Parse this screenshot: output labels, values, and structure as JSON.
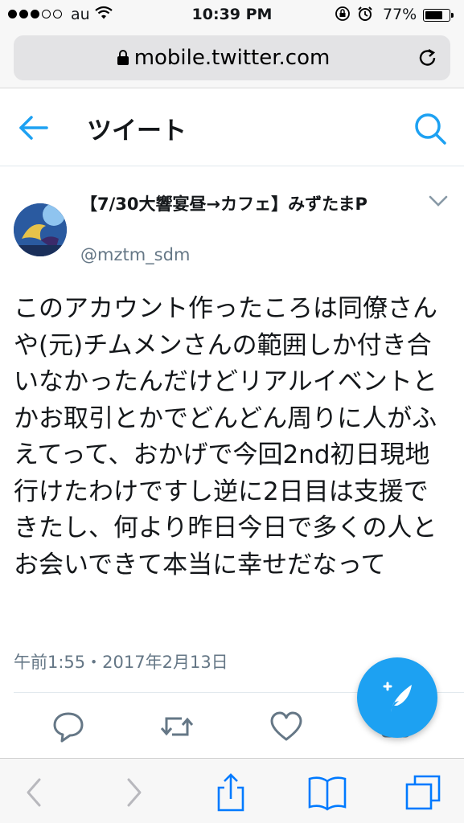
{
  "status_bar": {
    "carrier": "au",
    "time": "10:39 PM",
    "battery_percent": "77%",
    "battery_level": 0.77,
    "signal_bars_filled": 3,
    "signal_bars_total": 5
  },
  "browser": {
    "url": "mobile.twitter.com"
  },
  "header": {
    "title": "ツイート"
  },
  "tweet": {
    "display_name": "【7/30大響宴昼→カフェ】みずたまP",
    "handle": "@mztm_sdm",
    "text": "このアカウント作ったころは同僚さんや(元)チムメンさんの範囲しか付き合いなかったんだけどリアルイベントとかお取引とかでどんどん周りに人がふえてって、おかげで今回2nd初日現地行けたわけですし逆に2日目は支援できたし、何より昨日今日で多くの人とお会いできて本当に幸せだなって",
    "timestamp": "午前1:55・2017年2月13日"
  },
  "colors": {
    "accent": "#1da1f2",
    "secondary_text": "#657786",
    "ios_blue": "#007aff"
  },
  "icons": {
    "back": "arrow-left-icon",
    "search": "search-icon",
    "reply": "reply-icon",
    "retweet": "retweet-icon",
    "like": "heart-icon",
    "compose": "compose-tweet-icon"
  }
}
